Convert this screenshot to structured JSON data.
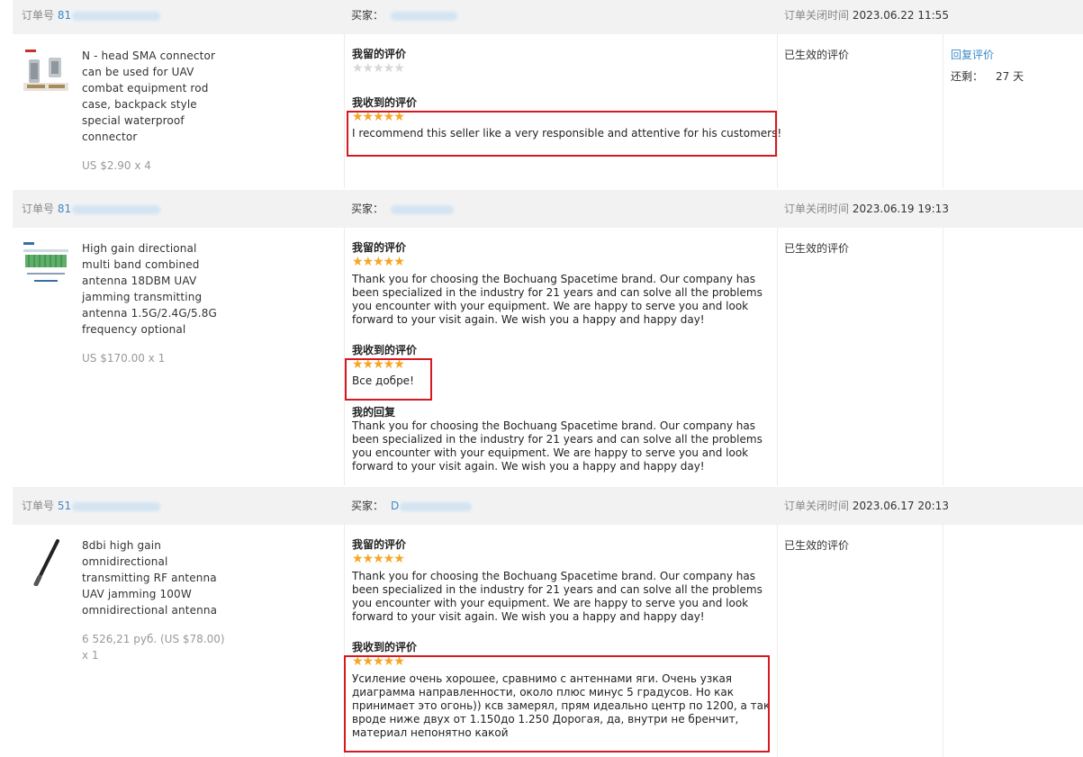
{
  "labels": {
    "order_no": "订单号",
    "buyer": "买家：",
    "closed_time": "订单关闭时间",
    "my_feedback": "我留的评价",
    "received_feedback": "我收到的评价",
    "my_reply": "我的回复",
    "effective": "已生效的评价",
    "reply_feedback": "回复评价",
    "remaining": "还剩：",
    "days_unit": "天"
  },
  "orders": [
    {
      "order_prefix": "81",
      "buyer_prefix": "",
      "closed_date": "2023.06.22 11:55",
      "product_title": "N - head SMA connector can be used for UAV combat equipment rod case, backpack style special waterproof connector",
      "product_title_lines": [
        "N - head SMA connector",
        "can be used for UAV",
        "combat equipment rod",
        "case, backpack style",
        "special waterproof",
        "connector"
      ],
      "price": "US $2.90 x 4",
      "my_feedback_rating": 0,
      "my_feedback_stars": "★★★★★",
      "received_rating": 5,
      "received_stars": "★★★★★",
      "received_text": "I recommend this seller like a very responsible and attentive for his customers!",
      "remaining_days": "27"
    },
    {
      "order_prefix": "81",
      "buyer_prefix": "",
      "closed_date": "2023.06.19 19:13",
      "product_title_lines": [
        "High gain directional",
        "multi band combined",
        "antenna 18DBM UAV",
        "jamming transmitting",
        "antenna 1.5G/2.4G/5.8G",
        "frequency optional"
      ],
      "price": "US $170.00 x 1",
      "my_feedback_rating": 5,
      "my_feedback_stars": "★★★★★",
      "my_feedback_lines": [
        "Thank you for choosing the Bochuang Spacetime brand. Our company has",
        "been specialized in the industry for 21 years and can solve all the problems",
        "you encounter with your equipment. We are happy to serve you and look",
        "forward to your visit again. We wish you a happy and happy day!"
      ],
      "received_rating": 5,
      "received_stars": "★★★★★",
      "received_text": "Все добре!",
      "reply_lines": [
        "Thank you for choosing the Bochuang Spacetime brand. Our company has",
        "been specialized in the industry for 21 years and can solve all the problems",
        "you encounter with your equipment. We are happy to serve you and look",
        "forward to your visit again. We wish you a happy and happy day!"
      ]
    },
    {
      "order_prefix": "51",
      "buyer_prefix": "D",
      "closed_date": "2023.06.17 20:13",
      "product_title_lines": [
        "8dbi high gain",
        "omnidirectional",
        "transmitting RF antenna",
        "UAV jamming 100W",
        "omnidirectional antenna"
      ],
      "price_lines": [
        "6 526,21 руб. (US $78.00)",
        "x 1"
      ],
      "my_feedback_rating": 5,
      "my_feedback_stars": "★★★★★",
      "my_feedback_lines": [
        "Thank you for choosing the Bochuang Spacetime brand. Our company has",
        "been specialized in the industry for 21 years and can solve all the problems",
        "you encounter with your equipment. We are happy to serve you and look",
        "forward to your visit again. We wish you a happy and happy day!"
      ],
      "received_rating": 5,
      "received_stars": "★★★★★",
      "received_lines": [
        "Усиление очень хорошее, сравнимо с антеннами яги. Очень узкая",
        "диаграмма направленности, около плюс минус 5 градусов. Но как",
        "принимает это огонь)) ксв замерял, прям идеально центр по 1200, а так",
        "вроде ниже двух от 1.150до 1.250 Дорогая, да, внутри не бренчит,",
        "материал непонятно какой"
      ]
    }
  ],
  "colors": {
    "accent_link": "#3a89c9",
    "star": "#f5a623",
    "highlight": "#d7181f"
  }
}
